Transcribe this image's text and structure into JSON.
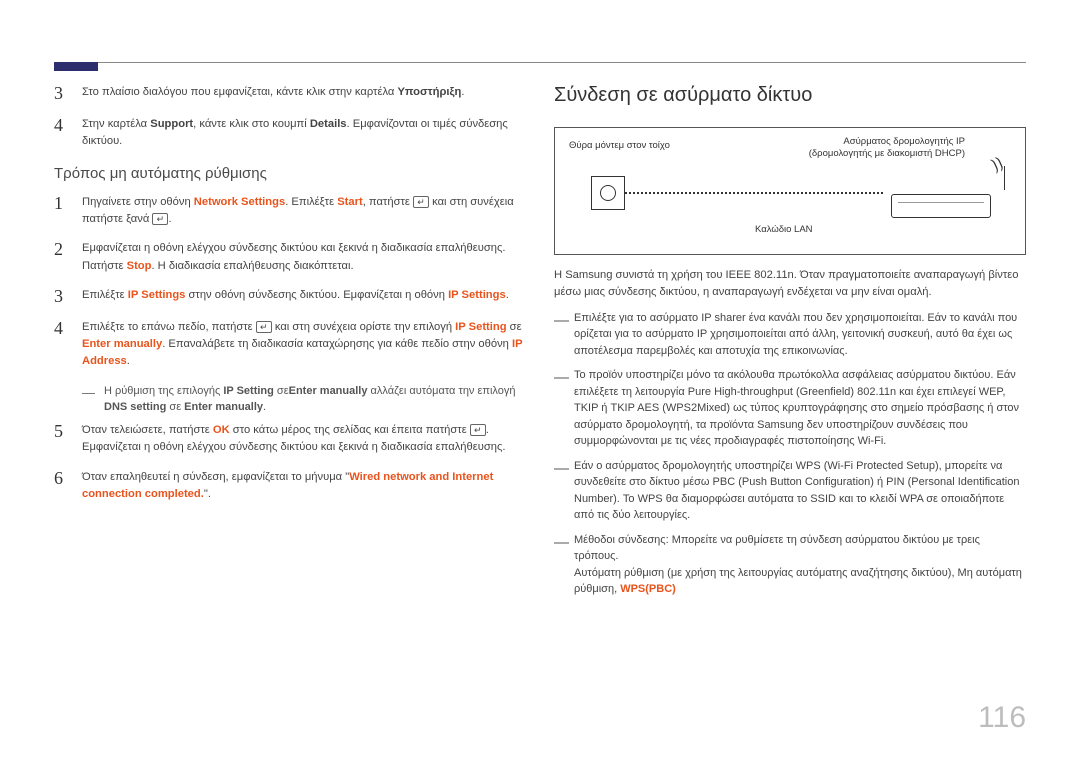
{
  "left": {
    "step3": {
      "pre": "Στο πλαίσιο διαλόγου που εμφανίζεται, κάντε κλικ στην καρτέλα ",
      "bold": "Υποστήριξη",
      "post": "."
    },
    "step4": {
      "pre": "Στην καρτέλα ",
      "b1": "Support",
      "mid": ", κάντε κλικ στο κουμπί ",
      "b2": "Details",
      "post": ". Εμφανίζονται οι τιμές σύνδεσης δικτύου."
    },
    "subhead": "Τρόπος μη αυτόματης ρύθμισης",
    "m1": {
      "pre": "Πηγαίνετε στην οθόνη ",
      "t1": "Network Settings",
      "mid1": ". Επιλέξτε ",
      "t2": "Start",
      "mid2": ", πατήστε ",
      "post": " και στη συνέχεια πατήστε ξανά "
    },
    "m2": {
      "line1": "Εμφανίζεται η οθόνη ελέγχου σύνδεσης δικτύου και ξεκινά η διαδικασία επαλήθευσης.",
      "pre2": "Πατήστε ",
      "t": "Stop",
      "post2": ". Η διαδικασία επαλήθευσης διακόπτεται."
    },
    "m3": {
      "pre": "Επιλέξτε ",
      "t1": "IP Settings",
      "mid": " στην οθόνη σύνδεσης δικτύου. Εμφανίζεται η οθόνη ",
      "t2": "IP Settings",
      "post": "."
    },
    "m4": {
      "pre": "Επιλέξτε το επάνω πεδίο, πατήστε ",
      "mid1": " και στη συνέχεια ορίστε την επιλογή ",
      "t1": "IP Setting",
      "mid2": " σε ",
      "t2": "Enter manually",
      "mid3": ". Επαναλάβετε τη διαδικασία καταχώρησης για κάθε πεδίο στην οθόνη ",
      "t3": "IP Address",
      "post": "."
    },
    "m4note": {
      "pre": "Η ρύθμιση της επιλογής ",
      "b1": "IP Setting",
      "mid1": " σε",
      "b2": "Enter manually",
      "mid2": " αλλάζει αυτόματα την επιλογή ",
      "b3": "DNS setting",
      "mid3": " σε ",
      "b4": "Enter manually",
      "post": "."
    },
    "m5": {
      "pre": "Όταν τελειώσετε, πατήστε ",
      "t1": "OK",
      "mid": " στο κάτω μέρος της σελίδας και έπειτα πατήστε ",
      "post": ". Εμφανίζεται η οθόνη ελέγχου σύνδεσης δικτύου και ξεκινά η διαδικασία επαλήθευσης."
    },
    "m6": {
      "pre": "Όταν επαληθευτεί η σύνδεση, εμφανίζεται το μήνυμα \"",
      "t": "Wired network and Internet connection completed.",
      "post": "\"."
    }
  },
  "right": {
    "title": "Σύνδεση σε ασύρματο δίκτυο",
    "diagram": {
      "wall": "Θύρα μόντεμ στον τοίχο",
      "router1": "Ασύρματος δρομολογητής IP",
      "router2": "(δρομολογητής με διακομιστή DHCP)",
      "lan": "Καλώδιο LAN"
    },
    "intro": "Η Samsung συνιστά τη χρήση του IEEE 802.11n. Όταν πραγματοποιείτε αναπαραγωγή βίντεο μέσω μιας σύνδεσης δικτύου, η αναπαραγωγή ενδέχεται να μην είναι ομαλή.",
    "n1": "Επιλέξτε για το ασύρματο IP sharer ένα κανάλι που δεν χρησιμοποιείται. Εάν το κανάλι που ορίζεται για το ασύρματο IP χρησιμοποιείται από άλλη, γειτονική συσκευή, αυτό θα έχει ως αποτέλεσμα παρεμβολές και αποτυχία της επικοινωνίας.",
    "n2": "Το προϊόν υποστηρίζει μόνο τα ακόλουθα πρωτόκολλα ασφάλειας ασύρματου δικτύου. Εάν επιλέξετε τη λειτουργία Pure High-throughput (Greenfield) 802.11n και έχει επιλεγεί WEP, TKIP ή TKIP AES (WPS2Mixed) ως τύπος κρυπτογράφησης στο σημείο πρόσβασης ή στον ασύρματο δρομολογητή, τα προϊόντα Samsung δεν υποστηρίζουν συνδέσεις που συμμορφώνονται με τις νέες προδιαγραφές πιστοποίησης Wi-Fi.",
    "n3": "Εάν ο ασύρματος δρομολογητής υποστηρίζει WPS (Wi-Fi Protected Setup), μπορείτε να συνδεθείτε στο δίκτυο μέσω PBC (Push Button Configuration) ή PIN (Personal Identification Number). Το WPS θα διαμορφώσει αυτόματα το SSID και το κλειδί WPA σε οποιαδήποτε από τις δύο λειτουργίες.",
    "n4a": "Μέθοδοι σύνδεσης: Μπορείτε να ρυθμίσετε τη σύνδεση ασύρματου δικτύου με τρεις τρόπους.",
    "n4b_pre": "Αυτόματη ρύθμιση (με χρήση της λειτουργίας αυτόματης αναζήτησης δικτύου), Μη αυτόματη ρύθμιση, ",
    "n4b_term": "WPS(PBC)"
  },
  "pageNumber": "116"
}
